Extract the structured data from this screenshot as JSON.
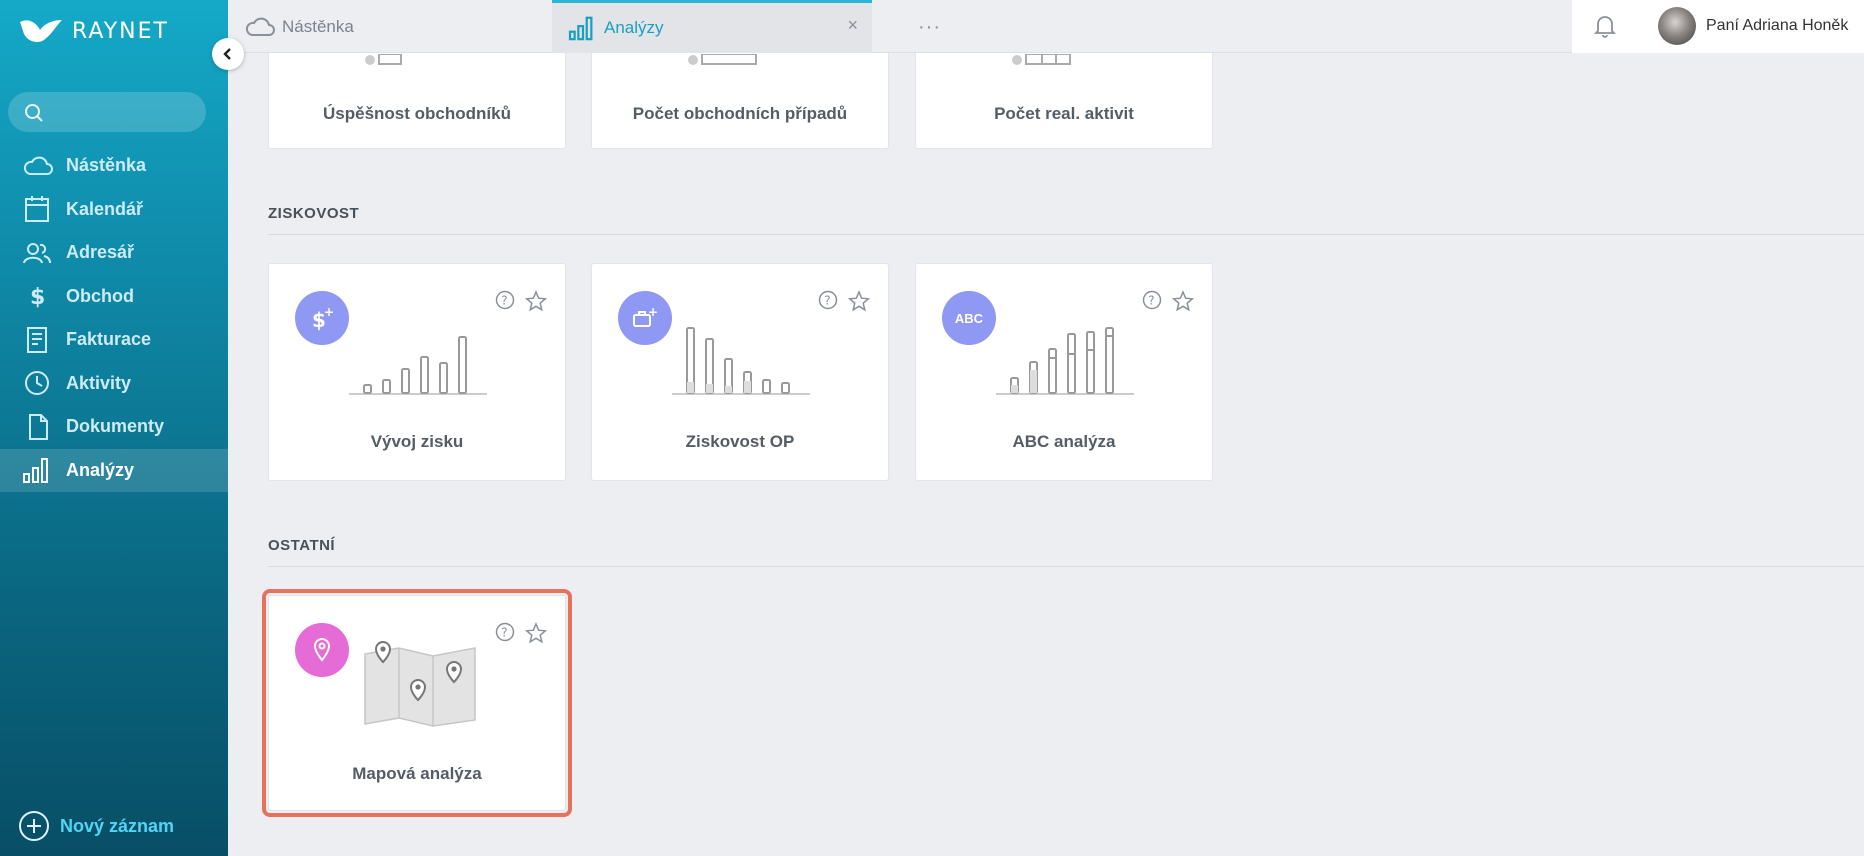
{
  "app": {
    "logo_text": "RAYNET"
  },
  "sidebar": {
    "items": [
      {
        "label": "Nástěnka",
        "icon": "cloud-icon"
      },
      {
        "label": "Kalendář",
        "icon": "calendar-icon"
      },
      {
        "label": "Adresář",
        "icon": "contacts-icon"
      },
      {
        "label": "Obchod",
        "icon": "dollar-icon"
      },
      {
        "label": "Fakturace",
        "icon": "invoice-icon"
      },
      {
        "label": "Aktivity",
        "icon": "clock-icon"
      },
      {
        "label": "Dokumenty",
        "icon": "document-icon"
      },
      {
        "label": "Analýzy",
        "icon": "bar-chart-icon",
        "active": true
      }
    ],
    "new_record_label": "Nový záznam"
  },
  "tabs": [
    {
      "label": "Nástěnka",
      "icon": "cloud-icon"
    },
    {
      "label": "Analýzy",
      "icon": "bar-chart-icon",
      "active": true,
      "close": "×"
    }
  ],
  "more_tabs": "···",
  "user": {
    "name": "Paní Adriana Honěk"
  },
  "sections": {
    "top_cards": [
      "Úspěšnost obchodníků",
      "Počet obchodních případů",
      "Počet real. aktivit"
    ],
    "ziskovost": {
      "label": "ZISKOVOST",
      "cards": [
        {
          "title": "Vývoj zisku",
          "badge_color": "#8f98f3",
          "badge_icon": "dollar-plus-icon"
        },
        {
          "title": "Ziskovost OP",
          "badge_color": "#8f98f3",
          "badge_icon": "briefcase-plus-icon"
        },
        {
          "title": "ABC analýza",
          "badge_color": "#8f98f3",
          "badge_text": "ABC"
        }
      ]
    },
    "ostatni": {
      "label": "OSTATNÍ",
      "cards": [
        {
          "title": "Mapová analýza",
          "badge_color": "#e56bd6",
          "badge_icon": "map-pin-icon",
          "highlighted": true,
          "highlight_color": "#e5735c"
        }
      ]
    }
  }
}
